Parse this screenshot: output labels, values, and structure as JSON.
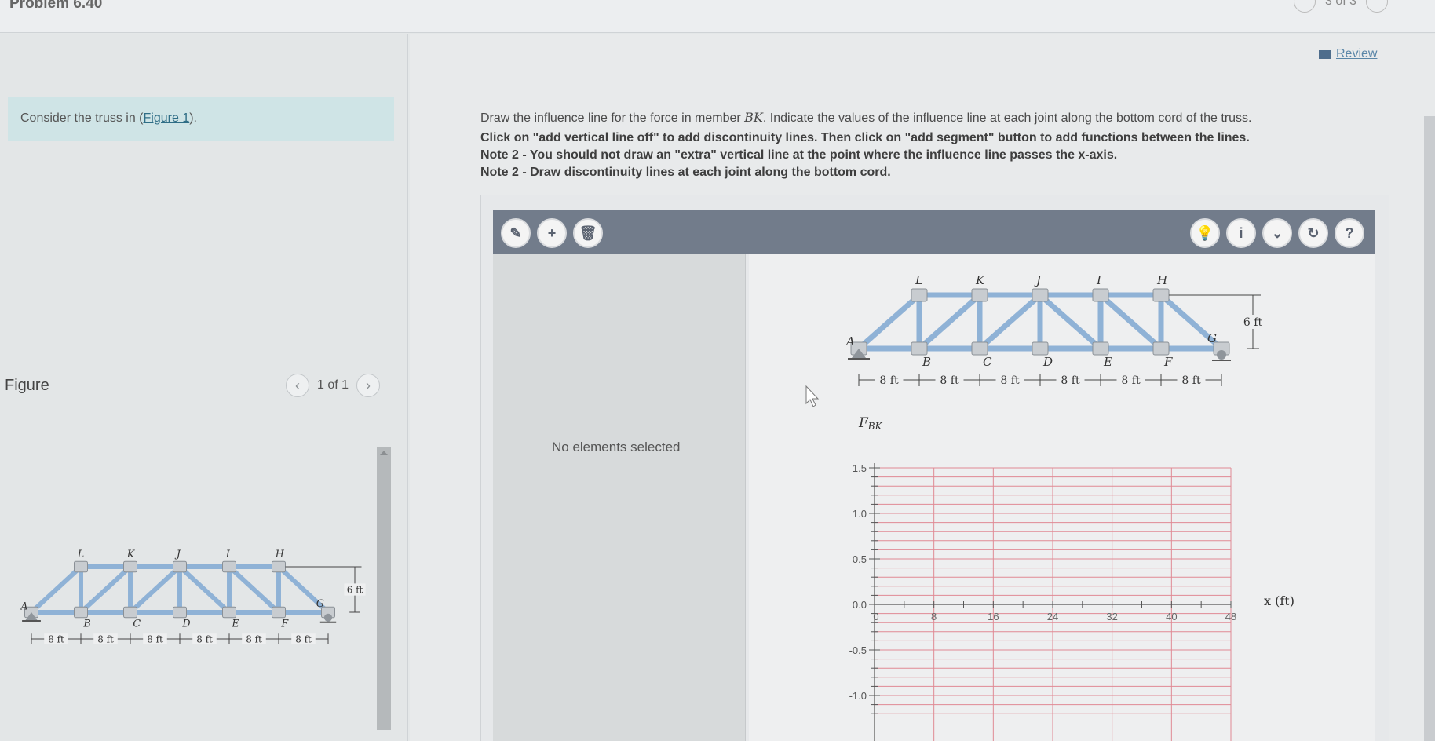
{
  "header": {
    "problem_title": "Problem 6.40",
    "pager_text": "3 of 3"
  },
  "left": {
    "consider_prefix": "Consider the truss in (",
    "figure_link": "Figure 1",
    "consider_suffix": ").",
    "figure_label": "Figure",
    "figure_count": "1 of 1"
  },
  "main": {
    "review_label": "Review",
    "instruction_prefix": "Draw the influence line for the force in member ",
    "instruction_member": "BK",
    "instruction_suffix": ". Indicate the values of the influence line at each joint along the bottom cord of the truss.",
    "note_1": "Click on \"add vertical line off\" to add discontinuity lines. Then click on \"add segment\" button to add functions between the lines.",
    "note_2": "Note 2 - You should not draw an \"extra\" vertical line at the point where the influence line passes the x-axis.",
    "note_3": "Note 2 - Draw discontinuity lines at each joint along the bottom cord.",
    "no_elements": "No elements selected"
  },
  "toolbar": {
    "tools_left": [
      {
        "name": "add-vertical-line-button",
        "icon": "pencil-plus-icon",
        "glyph": "✎"
      },
      {
        "name": "add-segment-button",
        "icon": "plus-icon",
        "glyph": "+"
      },
      {
        "name": "delete-button",
        "icon": "trash-icon",
        "glyph": "🗑"
      }
    ],
    "tools_right": [
      {
        "name": "hint-button",
        "icon": "lightbulb-icon",
        "glyph": "💡"
      },
      {
        "name": "info-button",
        "icon": "info-icon",
        "glyph": "i"
      },
      {
        "name": "dropdown-button",
        "icon": "chevron-down-icon",
        "glyph": "⌄"
      },
      {
        "name": "reset-button",
        "icon": "reset-icon",
        "glyph": "↻"
      },
      {
        "name": "help-button",
        "icon": "help-icon",
        "glyph": "?"
      }
    ]
  },
  "truss": {
    "top_joints": [
      "L",
      "K",
      "J",
      "I",
      "H"
    ],
    "bottom_joints": [
      "B",
      "C",
      "D",
      "E",
      "F"
    ],
    "left_support": "A",
    "right_support": "G",
    "panel_label": "8 ft",
    "height_label": "6 ft",
    "panel_count": 6
  },
  "graph": {
    "y_axis_label": "F",
    "y_axis_subscript": "BK",
    "x_axis_label": "x (ft)",
    "x_ticks": [
      "0",
      "8",
      "16",
      "24",
      "32",
      "40",
      "48"
    ],
    "y_ticks": [
      "1.5",
      "1.0",
      "0.5",
      "0.0",
      "-0.5",
      "-1.0"
    ],
    "y_tick_values": [
      1.5,
      1.0,
      0.5,
      0.0,
      -0.5,
      -1.0
    ],
    "x_tick_values": [
      0,
      8,
      16,
      24,
      32,
      40,
      48
    ],
    "y_minor_step": 0.1,
    "grid_color": "#e08a94"
  },
  "colors": {
    "truss_member": "#8fb2d6",
    "toolbar": "#727c8b",
    "consider_bg": "#cfe4e6"
  }
}
